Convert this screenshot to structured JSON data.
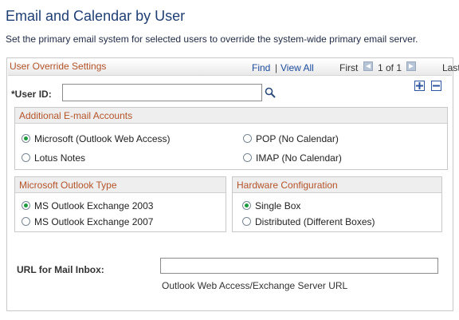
{
  "page": {
    "title": "Email and Calendar by User",
    "description": "Set the primary email system for selected users to override the system-wide primary email server."
  },
  "grid": {
    "title": "User Override Settings",
    "find_label": "Find",
    "separator": "|",
    "view_all_label": "View All",
    "first_label": "First",
    "count_text": "1 of 1",
    "last_label": "Last"
  },
  "user_id": {
    "label": "*User ID:",
    "value": "",
    "placeholder": ""
  },
  "email_accounts": {
    "title": "Additional E-mail Accounts",
    "options": [
      {
        "label": "Microsoft (Outlook Web Access)",
        "checked": true
      },
      {
        "label": "POP (No Calendar)",
        "checked": false
      },
      {
        "label": "Lotus Notes",
        "checked": false
      },
      {
        "label": "IMAP (No Calendar)",
        "checked": false
      }
    ]
  },
  "outlook_type": {
    "title": "Microsoft Outlook Type",
    "options": [
      {
        "label": "MS Outlook Exchange 2003",
        "checked": true
      },
      {
        "label": "MS Outlook Exchange 2007",
        "checked": false
      }
    ]
  },
  "hardware": {
    "title": "Hardware Configuration",
    "options": [
      {
        "label": "Single Box",
        "checked": true
      },
      {
        "label": "Distributed (Different Boxes)",
        "checked": false
      }
    ]
  },
  "url": {
    "label": "URL for Mail Inbox:",
    "value": "",
    "help": "Outlook Web Access/Exchange Server URL"
  },
  "colors": {
    "title_blue": "#1f3f74",
    "section_orange": "#b4532a",
    "link_blue": "#1b4b9c",
    "radio_green": "#1c9b3c"
  }
}
